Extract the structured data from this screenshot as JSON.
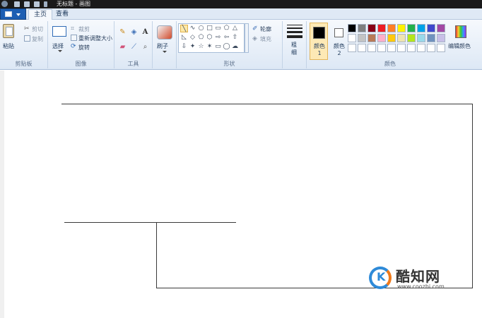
{
  "window": {
    "title": "无标题 - 画图",
    "quick_access": [
      "save-icon",
      "undo-icon",
      "redo-icon"
    ]
  },
  "tabs": [
    {
      "label": "主页",
      "active": true
    },
    {
      "label": "查看",
      "active": false
    }
  ],
  "ribbon": {
    "clipboard": {
      "group_label": "剪贴板",
      "paste_label": "粘贴",
      "cut_label": "剪切",
      "copy_label": "复制"
    },
    "image": {
      "group_label": "图像",
      "select_label": "选择",
      "crop_label": "裁剪",
      "resize_label": "重新调整大小",
      "rotate_label": "旋转"
    },
    "tools": {
      "group_label": "工具",
      "items": [
        "pencil-icon",
        "fill-icon",
        "text-icon",
        "eraser-icon",
        "color-picker-icon",
        "magnifier-icon"
      ],
      "text_glyph": "A"
    },
    "brushes": {
      "label": "刷子"
    },
    "shapes": {
      "group_label": "形状",
      "outline_label": "轮廓",
      "fill_label": "填充",
      "glyphs": [
        "╲",
        "∿",
        "○",
        "□",
        "▭",
        "⬠",
        "△",
        "◺",
        "◇",
        "⬠",
        "⬡",
        "⇨",
        "⇦",
        "⇧",
        "⇩",
        "✦",
        "☆",
        "✶",
        "▭",
        "◯",
        "☁",
        "♡",
        "⚡",
        "☐"
      ]
    },
    "size": {
      "label": "粗细"
    },
    "colors": {
      "group_label": "颜色",
      "color1_label": "颜色 1",
      "color2_label": "颜色 2",
      "edit_label": "编辑颜色",
      "color1": "#000000",
      "color2": "#ffffff",
      "palette_row1": [
        "#000000",
        "#7f7f7f",
        "#880015",
        "#ed1c24",
        "#ff7f27",
        "#fff200",
        "#22b14c",
        "#00a2e8",
        "#3f48cc",
        "#a349a4"
      ],
      "palette_row2": [
        "#ffffff",
        "#c3c3c3",
        "#b97a57",
        "#ffaec9",
        "#ffc90e",
        "#efe4b0",
        "#b5e61d",
        "#99d9ea",
        "#7092be",
        "#c8bfe7"
      ],
      "palette_row3": [
        "#ffffff",
        "#ffffff",
        "#ffffff",
        "#ffffff",
        "#ffffff",
        "#ffffff",
        "#ffffff",
        "#ffffff",
        "#ffffff",
        "#ffffff"
      ]
    }
  },
  "watermark": {
    "logo_letter": "K",
    "title": "酷知网",
    "url": "www.coozhi.com"
  }
}
